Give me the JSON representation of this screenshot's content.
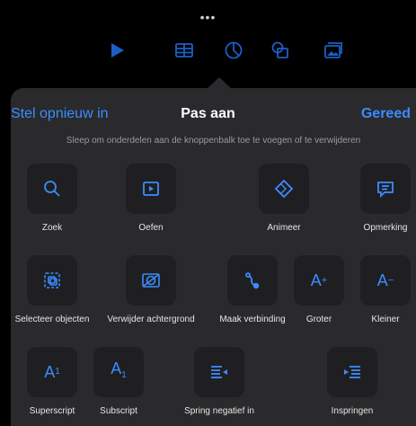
{
  "toolbar": {
    "more_indicator": "•••",
    "icons": [
      "play-icon",
      "table-icon",
      "chart-icon",
      "shapes-icon",
      "media-icon"
    ]
  },
  "header": {
    "reset_label": "Stel opnieuw in",
    "title": "Pas aan",
    "done_label": "Gereed"
  },
  "hint": "Sleep om onderdelen aan de knoppenbalk toe te voegen of te verwijderen",
  "tools": [
    {
      "label": "Zoek",
      "icon": "search-icon"
    },
    {
      "label": "Oefen",
      "icon": "rehearse-icon"
    },
    {
      "label": "Animeer",
      "icon": "animate-icon"
    },
    {
      "label": "Opmerking",
      "icon": "comment-icon"
    },
    {
      "label": "Selecteer objecten",
      "icon": "select-objects-icon"
    },
    {
      "label": "Verwijder achtergrond",
      "icon": "remove-background-icon"
    },
    {
      "label": "Maak verbinding",
      "icon": "connection-line-icon"
    },
    {
      "label": "Groter",
      "icon": "font-bigger-icon",
      "glyph": "A+"
    },
    {
      "label": "Kleiner",
      "icon": "font-smaller-icon",
      "glyph": "A−"
    },
    {
      "label": "Superscript",
      "icon": "superscript-icon",
      "glyph": "A¹"
    },
    {
      "label": "Subscript",
      "icon": "subscript-icon",
      "glyph": "A₁"
    },
    {
      "label": "Spring negatief in",
      "icon": "outdent-icon"
    },
    {
      "label": "Inspringen",
      "icon": "indent-icon"
    }
  ],
  "colors": {
    "accent": "#3b8cff",
    "panel": "#2a2a2c",
    "tile": "#1f1f21",
    "toolbar_icon": "#1b5fc4"
  }
}
